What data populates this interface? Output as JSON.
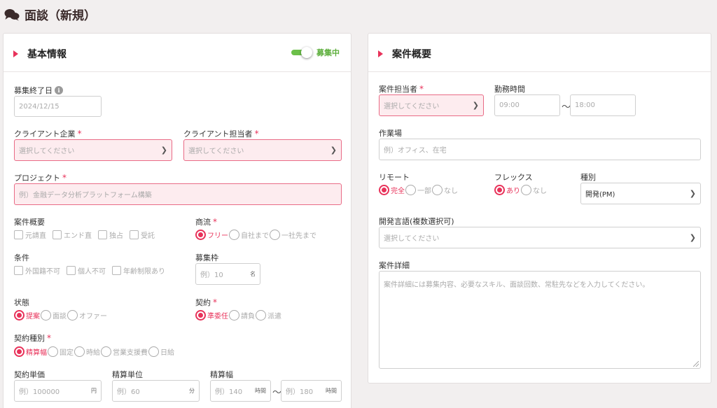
{
  "page": {
    "title": "面談（新規）"
  },
  "colors": {
    "accent": "#e8325a",
    "toggle_on": "#6cc04a",
    "required_bg": "#fdecef"
  },
  "basic": {
    "title": "基本情報",
    "toggle": {
      "label": "募集中",
      "on": true
    },
    "deadline": {
      "label": "募集終了日",
      "value": "2024/12/15"
    },
    "client": {
      "label": "クライアント企業",
      "placeholder": "選択してください"
    },
    "client_contact": {
      "label": "クライアント担当者",
      "placeholder": "選択してください"
    },
    "project": {
      "label": "プロジェクト",
      "placeholder": "例）金融データ分析プラットフォーム構築"
    },
    "overview": {
      "label": "案件概要",
      "options": [
        "元請直",
        "エンド直",
        "独占",
        "受託"
      ]
    },
    "commerce": {
      "label": "商流",
      "options": [
        "フリー",
        "自社まで",
        "一社先まで"
      ],
      "selected": "フリー"
    },
    "conditions": {
      "label": "条件",
      "options": [
        "外国籍不可",
        "個人不可",
        "年齢制限あり"
      ]
    },
    "slots": {
      "label": "募集枠",
      "placeholder": "例）10",
      "unit": "名"
    },
    "status": {
      "label": "状態",
      "options": [
        "提案",
        "面談",
        "オファー"
      ],
      "selected": "提案"
    },
    "contract": {
      "label": "契約",
      "options": [
        "準委任",
        "請負",
        "派遣"
      ],
      "selected": "準委任"
    },
    "contract_type": {
      "label": "契約種別",
      "options": [
        "精算幅",
        "固定",
        "時給",
        "営業支援費",
        "日給"
      ],
      "selected": "精算幅"
    },
    "unit_price": {
      "label": "契約単価",
      "placeholder": "例）100000",
      "unit": "円"
    },
    "settle_unit": {
      "label": "精算単位",
      "placeholder": "例）60",
      "unit": "分"
    },
    "settle_range": {
      "label": "精算幅",
      "min_placeholder": "例）140",
      "max_placeholder": "例）180",
      "unit": "時間",
      "separator": "〜"
    }
  },
  "summary": {
    "title": "案件概要",
    "owner": {
      "label": "案件担当者",
      "placeholder": "選択してください"
    },
    "hours": {
      "label": "勤務時間",
      "start_placeholder": "09:00",
      "end_placeholder": "18:00",
      "separator": "〜"
    },
    "workplace": {
      "label": "作業場",
      "placeholder": "例）オフィス、在宅"
    },
    "remote": {
      "label": "リモート",
      "options": [
        "完全",
        "一部",
        "なし"
      ],
      "selected": "完全"
    },
    "flex": {
      "label": "フレックス",
      "options": [
        "あり",
        "なし"
      ],
      "selected": "あり"
    },
    "kind": {
      "label": "種別",
      "value": "開発(PM)"
    },
    "languages": {
      "label": "開発言語(複数選択可)",
      "placeholder": "選択してください"
    },
    "details": {
      "label": "案件詳細",
      "placeholder": "案件詳細には募集内容、必要なスキル、面談回数、常駐先などを入力してください。"
    }
  }
}
